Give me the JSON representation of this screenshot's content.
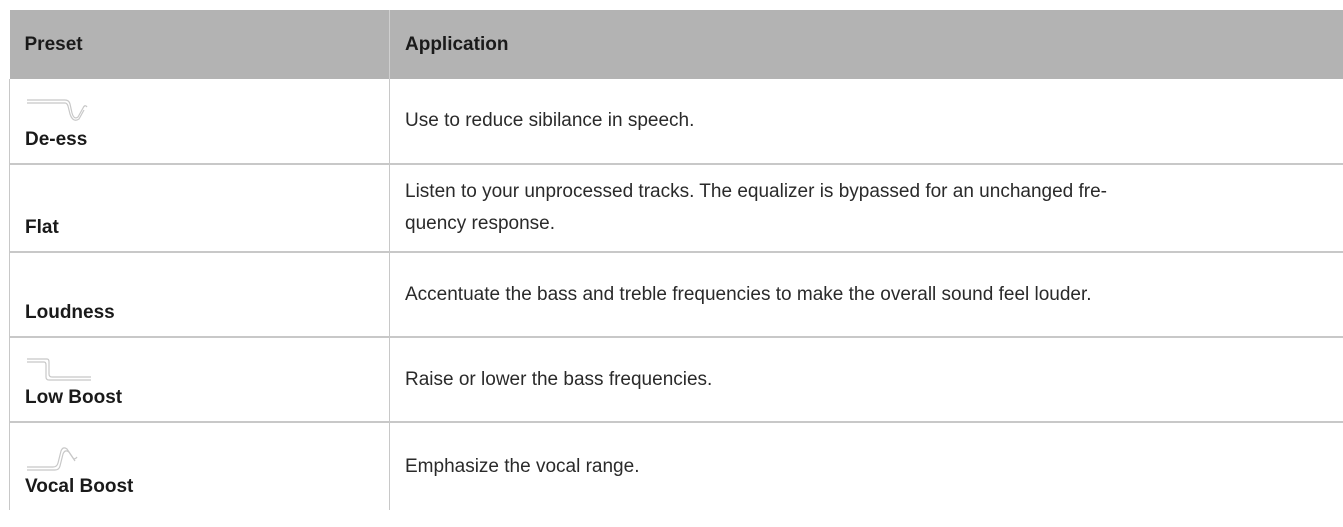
{
  "table": {
    "headers": {
      "preset": "Preset",
      "application": "Application"
    },
    "rows": [
      {
        "name": "De-ess",
        "icon": "de-ess-curve-icon",
        "application": "Use to reduce sibilance in speech."
      },
      {
        "name": "Flat",
        "icon": "",
        "application": "Listen to your unprocessed tracks. The equalizer is bypassed for an unchanged fre-\nquency response."
      },
      {
        "name": "Loudness",
        "icon": "",
        "application": "Accentuate the bass and treble frequencies to make the overall sound feel louder."
      },
      {
        "name": "Low Boost",
        "icon": "low-boost-curve-icon",
        "application": "Raise or lower the bass frequencies."
      },
      {
        "name": "Vocal Boost",
        "icon": "vocal-boost-curve-icon",
        "application": "Emphasize the vocal range."
      }
    ]
  },
  "colors": {
    "header_background": "#b3b3b3",
    "row_border": "#c8c8c8",
    "icon_stroke": "#c8c8c8"
  }
}
